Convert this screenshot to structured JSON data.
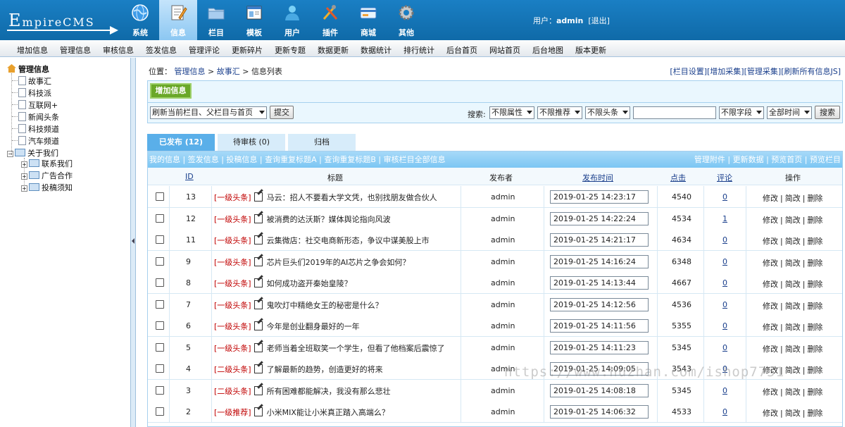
{
  "header": {
    "logo_text_big": "E",
    "logo_text_rest": "mpireCMS",
    "nav": [
      {
        "label": "系统",
        "icon": "globe-icon",
        "active": false
      },
      {
        "label": "信息",
        "icon": "notepad-icon",
        "active": true
      },
      {
        "label": "栏目",
        "icon": "folder-icon",
        "active": false
      },
      {
        "label": "模板",
        "icon": "window-icon",
        "active": false
      },
      {
        "label": "用户",
        "icon": "user-icon",
        "active": false
      },
      {
        "label": "插件",
        "icon": "tools-icon",
        "active": false
      },
      {
        "label": "商城",
        "icon": "card-icon",
        "active": false
      },
      {
        "label": "其他",
        "icon": "gear-icon",
        "active": false
      }
    ],
    "user_label": "用户：",
    "user_name": "admin",
    "logout": "[退出]"
  },
  "menubar": [
    "增加信息",
    "管理信息",
    "审核信息",
    "签发信息",
    "管理评论",
    "更新碎片",
    "更新专题",
    "数据更新",
    "数据统计",
    "排行统计",
    "后台首页",
    "网站首页",
    "后台地图",
    "版本更新"
  ],
  "tree": {
    "root": "管理信息",
    "items": [
      "故事汇",
      "科技派",
      "互联网+",
      "新闻头条",
      "科技频道",
      "汽车频道"
    ],
    "group": "关于我们",
    "sub": [
      "联系我们",
      "广告合作",
      "投稿须知"
    ]
  },
  "crumb": {
    "label": "位置：",
    "path1": "管理信息",
    "sep1": " > ",
    "path2": "故事汇",
    "sep2": " > ",
    "path3": "信息列表"
  },
  "toplinks": [
    "[栏目设置]",
    "[增加采集]",
    "[管理采集]",
    "[刷新所有信息JS]"
  ],
  "actions": {
    "add_button": "增加信息",
    "refresh_select": "刷新当前栏目、父栏目与首页",
    "submit": "提交",
    "search_label": "搜索:",
    "filters": [
      "不限属性",
      "不限推荐",
      "不限头条"
    ],
    "field_select": "不限字段",
    "time_select": "全部时间",
    "search_button": "搜索"
  },
  "tabs": [
    {
      "label": "已发布 (12)",
      "active": true
    },
    {
      "label": "待审核 (0)",
      "active": false
    },
    {
      "label": "归档",
      "active": false
    }
  ],
  "linkbar": {
    "left": [
      "我的信息",
      "签发信息",
      "投稿信息",
      "查询重复标题A",
      "查询重复标题B",
      "审核栏目全部信息"
    ],
    "right": [
      "管理附件",
      "更新数据",
      "预览首页",
      "预览栏目"
    ]
  },
  "columns": {
    "id": "ID",
    "title": "标题",
    "author": "发布者",
    "time": "发布时间",
    "hits": "点击",
    "comments": "评论",
    "ops": "操作"
  },
  "ops": {
    "edit": "修改",
    "quick": "简改",
    "delete": "删除",
    "sep": "|"
  },
  "rows": [
    {
      "id": "13",
      "tag": "[一级头条]",
      "title": "马云：招人不要看大学文凭，也别找朋友做合伙人",
      "author": "admin",
      "time": "2019-01-25 14:23:17",
      "hits": "4540",
      "comments": "0"
    },
    {
      "id": "12",
      "tag": "[一级头条]",
      "title": "被消费的达沃斯？媒体舆论指向风波",
      "author": "admin",
      "time": "2019-01-25 14:22:24",
      "hits": "4534",
      "comments": "1"
    },
    {
      "id": "11",
      "tag": "[一级头条]",
      "title": "云集微店：社交电商新形态，争议中谋美股上市",
      "author": "admin",
      "time": "2019-01-25 14:21:17",
      "hits": "4634",
      "comments": "0"
    },
    {
      "id": "9",
      "tag": "[一级头条]",
      "title": "芯片巨头们2019年的AI芯片之争会如何？",
      "author": "admin",
      "time": "2019-01-25 14:16:24",
      "hits": "6348",
      "comments": "0"
    },
    {
      "id": "8",
      "tag": "[一级头条]",
      "title": "如何成功盗开秦始皇陵？",
      "author": "admin",
      "time": "2019-01-25 14:13:44",
      "hits": "4667",
      "comments": "0"
    },
    {
      "id": "7",
      "tag": "[一级头条]",
      "title": "鬼吹灯中精绝女王的秘密是什么？",
      "author": "admin",
      "time": "2019-01-25 14:12:56",
      "hits": "4536",
      "comments": "0"
    },
    {
      "id": "6",
      "tag": "[一级头条]",
      "title": "今年是创业翻身最好的一年",
      "author": "admin",
      "time": "2019-01-25 14:11:56",
      "hits": "5355",
      "comments": "0"
    },
    {
      "id": "5",
      "tag": "[一级头条]",
      "title": "老师当着全班取笑一个学生，但看了他档案后震惊了",
      "author": "admin",
      "time": "2019-01-25 14:11:23",
      "hits": "5345",
      "comments": "0"
    },
    {
      "id": "4",
      "tag": "[二级头条]",
      "title": "了解最新的趋势，创造更好的将来",
      "author": "admin",
      "time": "2019-01-25 14:09:05",
      "hits": "3543",
      "comments": "0"
    },
    {
      "id": "3",
      "tag": "[二级头条]",
      "title": "所有困难都能解决，我没有那么悲壮",
      "author": "admin",
      "time": "2019-01-25 14:08:18",
      "hits": "5345",
      "comments": "0"
    },
    {
      "id": "2",
      "tag": "[一级推荐]",
      "title": "小米MIX能让小米真正踏入高端么？",
      "author": "admin",
      "time": "2019-01-25 14:06:32",
      "hits": "4533",
      "comments": "0"
    }
  ],
  "watermark": "https://www.huzhan.com/ishop7751"
}
